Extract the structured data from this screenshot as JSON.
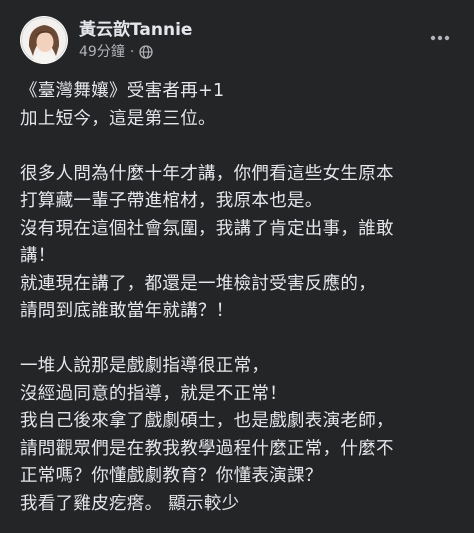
{
  "post": {
    "author": "黃云歆Tannie",
    "timestamp": "49分鐘",
    "separator": "·",
    "audience_icon": "globe-icon",
    "more_icon": "more-options-icon",
    "lines": [
      "《臺灣舞孃》受害者再+1",
      "加上短今，這是第三位。",
      "",
      "很多人問為什麼十年才講，你們看這些女生原本",
      "打算藏一輩子帶進棺材，我原本也是。",
      "沒有現在這個社會氛圍，我講了肯定出事，誰敢",
      "講！",
      "就連現在講了，都還是一堆檢討受害反應的，",
      "請問到底誰敢當年就講？！",
      "",
      "一堆人說那是戲劇指導很正常，",
      "沒經過同意的指導，就是不正常！",
      "我自己後來拿了戲劇碩士，也是戲劇表演老師，",
      "請問觀眾們是在教我教學過程什麼正常，什麼不",
      "正常嗎？你懂戲劇教育？你懂表演課？",
      "我看了雞皮疙瘩。 顯示較少"
    ]
  }
}
